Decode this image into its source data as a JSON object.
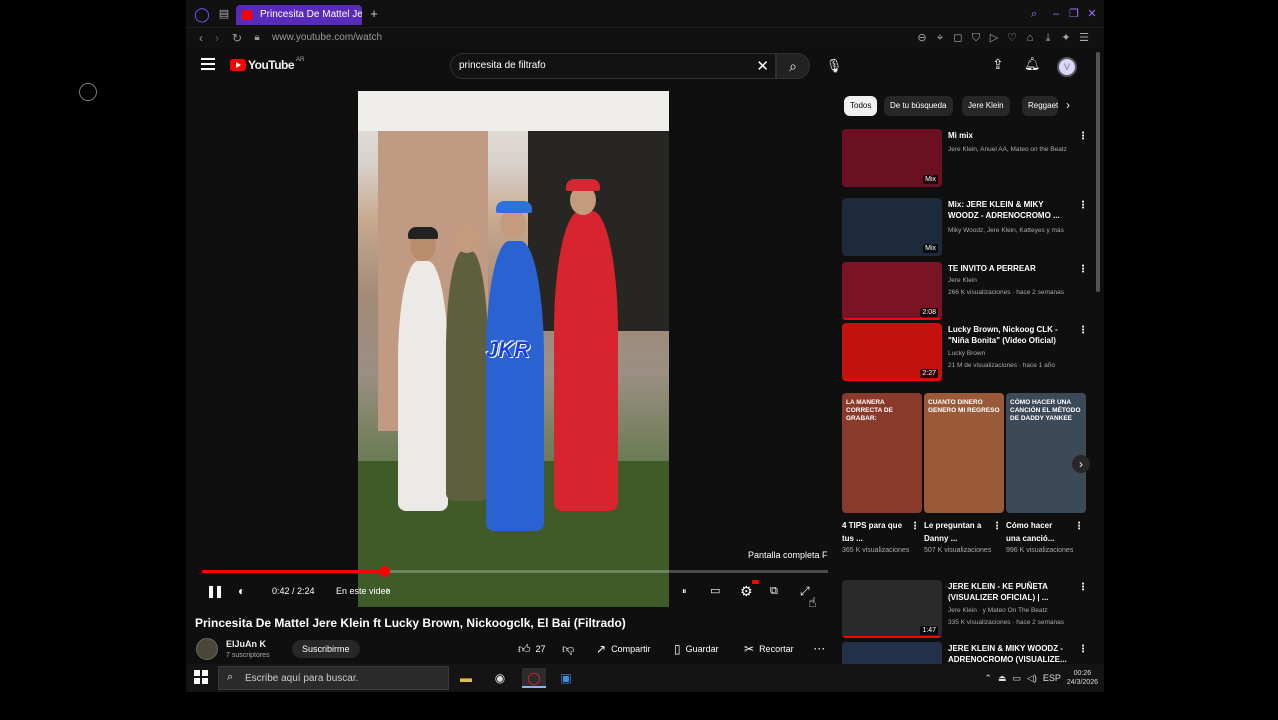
{
  "browser": {
    "tab_title": "Princesita De Mattel Je",
    "url": "www.youtube.com/watch",
    "icons": [
      "opera-logo",
      "tab-switcher-icon",
      "new-tab-icon",
      "search-icon",
      "minimize-icon",
      "maximize-icon",
      "close-icon"
    ]
  },
  "youtube": {
    "logo_text": "YouTube",
    "country_code": "AR",
    "search": {
      "value": "princesita de filtrafo",
      "clear": "✕"
    },
    "avatar_letter": "V"
  },
  "player": {
    "fullscreen_tooltip": "Pantalla completa  F",
    "time": "0:42 / 2:24",
    "chapter_label": "En este video",
    "progress_fraction": 0.29,
    "watermark": "JKR"
  },
  "video": {
    "title": "Princesita De Mattel Jere Klein ft Lucky Brown, Nickoogclk, El Bai (Filtrado)",
    "channel_name": "ElJuAn K",
    "channel_subs": "7 suscriptores",
    "subscribe_label": "Suscribirme",
    "like_count": "27",
    "share_label": "Compartir",
    "save_label": "Guardar",
    "clip_label": "Recortar"
  },
  "chips": [
    "Todos",
    "De tu búsqueda",
    "Jere Klein",
    "Reggaeton"
  ],
  "recommendations": [
    {
      "title": "Mi mix",
      "meta1": "Jere Klein, Anuel AA, Mateo on the Beatz",
      "meta2": "",
      "badge": "Mix",
      "thumb": "#6b1020"
    },
    {
      "title": "Mix: JERE KLEIN & MIKY WOODZ - ADRENOCROMO ...",
      "meta1": "Miky Woodz, Jere Klein, Katteyes y más",
      "meta2": "",
      "badge": "Mix",
      "thumb": "#1c2a3c"
    },
    {
      "title": "TE INVITO A PERREAR",
      "meta1": "Jere Klein",
      "meta2": "266 K visualizaciones · hace 2 semanas",
      "badge": "2:08",
      "thumb": "#7a1424"
    },
    {
      "title": "Lucky Brown, Nickoog CLK - \"Niña Bonita\" (Video Oficial)",
      "meta1": "Lucky Brown",
      "meta2": "21 M de visualizaciones · hace 1 año",
      "badge": "2:27",
      "thumb": "#c4120f"
    },
    {
      "title": "JERE KLEIN - KE PUÑETA (VISUALIZER OFICIAL) | ...",
      "meta1": "Jere Klein · y Mateo On The Beatz",
      "meta2": "335 K visualizaciones · hace 2 semanas",
      "badge": "1:47",
      "thumb": "#2a2a2a"
    },
    {
      "title": "JERE KLEIN & MIKY WOODZ - ADRENOCROMO (VISUALIZE...",
      "meta1": "",
      "meta2": "",
      "badge": "",
      "thumb": "#23324a"
    }
  ],
  "shorts": [
    {
      "overlay": "LA MANERA CORRECTA DE GRABAR:",
      "title": "4 TIPS para que tus ...",
      "views": "365 K visualizaciones",
      "thumb": "#8a3a2a"
    },
    {
      "overlay": "CUANTO DINERO GENERO MI REGRESO",
      "title": "Le preguntan a Danny ...",
      "views": "507 K visualizaciones",
      "thumb": "#9a5a38"
    },
    {
      "overlay": "CÓMO HACER UNA CANCIÓN EL MÉTODO DE DADDY YANKEE",
      "title": "Cómo hacer una canció...",
      "views": "996 K visualizaciones",
      "thumb": "#3c4a58"
    }
  ],
  "taskbar": {
    "search_placeholder": "Escribe aquí para buscar.",
    "language": "ESP",
    "time": "00:26",
    "date": "24/3/2026"
  }
}
